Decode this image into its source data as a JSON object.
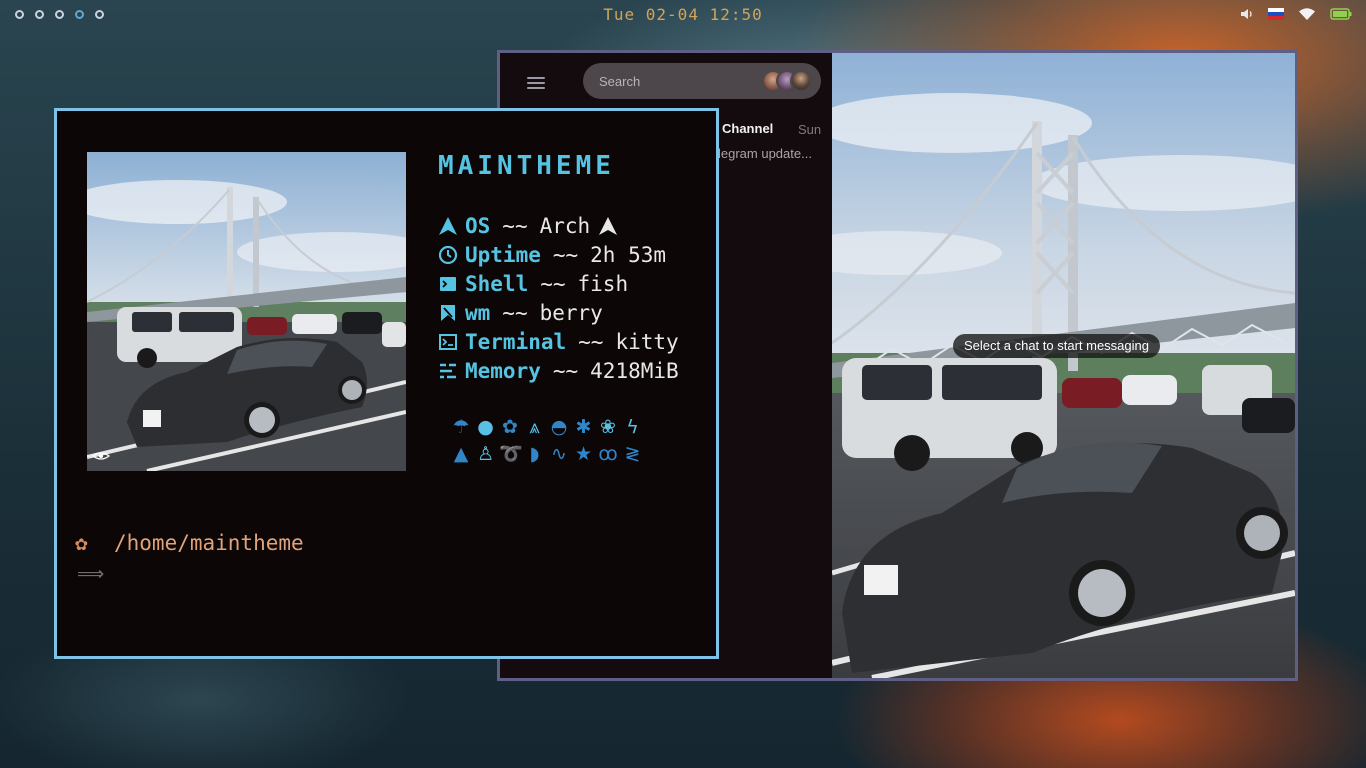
{
  "topbar": {
    "workspaces": [
      {
        "id": 1,
        "active": false
      },
      {
        "id": 2,
        "active": false
      },
      {
        "id": 3,
        "active": false
      },
      {
        "id": 4,
        "active": true
      },
      {
        "id": 5,
        "active": false
      }
    ],
    "clock": "Tue 02-04 12:50",
    "tray_icons": [
      "volume-icon",
      "russian-flag-icon",
      "wifi-icon",
      "battery-icon"
    ]
  },
  "telegram": {
    "search_placeholder": "Search",
    "chat": {
      "name": "Channel",
      "date": "Sun",
      "preview": "legram update..."
    },
    "empty_hint": "Select a chat to start messaging"
  },
  "terminal": {
    "title": "MAINTHEME",
    "info": [
      {
        "icon": "arch-icon",
        "label": "OS",
        "value": "Arch"
      },
      {
        "icon": "clock-icon",
        "label": "Uptime",
        "value": "2h 53m"
      },
      {
        "icon": "shell-icon",
        "label": "Shell",
        "value": "fish"
      },
      {
        "icon": "window-manager-icon",
        "label": "wm",
        "value": "berry"
      },
      {
        "icon": "terminal-icon",
        "label": "Terminal",
        "value": "kitty"
      },
      {
        "icon": "memory-icon",
        "label": "Memory",
        "value": "4218MiB"
      }
    ],
    "separator": "~~",
    "cwd": "/home/maintheme",
    "prompt": "⟹"
  },
  "colors": {
    "accent": "#55c3e2",
    "clock": "#d2a35a",
    "term_border": "#7fc2e8",
    "tg_border": "#5f5f85",
    "cwd": "#e0a27a"
  }
}
